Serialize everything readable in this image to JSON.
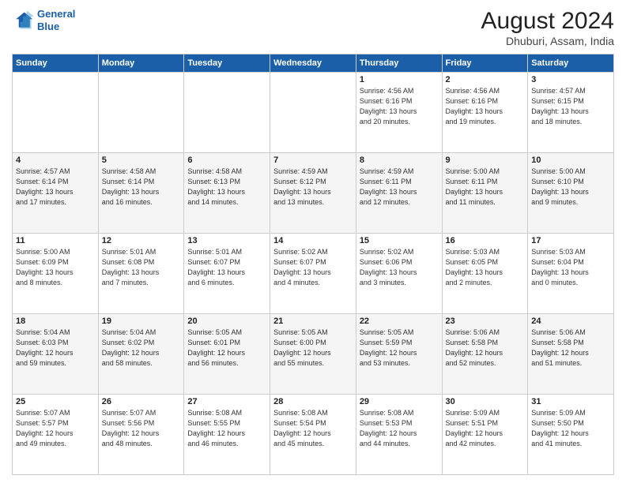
{
  "header": {
    "logo": {
      "line1": "General",
      "line2": "Blue"
    },
    "title": "August 2024",
    "subtitle": "Dhuburi, Assam, India"
  },
  "weekdays": [
    "Sunday",
    "Monday",
    "Tuesday",
    "Wednesday",
    "Thursday",
    "Friday",
    "Saturday"
  ],
  "weeks": [
    [
      {
        "day": "",
        "info": ""
      },
      {
        "day": "",
        "info": ""
      },
      {
        "day": "",
        "info": ""
      },
      {
        "day": "",
        "info": ""
      },
      {
        "day": "1",
        "info": "Sunrise: 4:56 AM\nSunset: 6:16 PM\nDaylight: 13 hours\nand 20 minutes."
      },
      {
        "day": "2",
        "info": "Sunrise: 4:56 AM\nSunset: 6:16 PM\nDaylight: 13 hours\nand 19 minutes."
      },
      {
        "day": "3",
        "info": "Sunrise: 4:57 AM\nSunset: 6:15 PM\nDaylight: 13 hours\nand 18 minutes."
      }
    ],
    [
      {
        "day": "4",
        "info": "Sunrise: 4:57 AM\nSunset: 6:14 PM\nDaylight: 13 hours\nand 17 minutes."
      },
      {
        "day": "5",
        "info": "Sunrise: 4:58 AM\nSunset: 6:14 PM\nDaylight: 13 hours\nand 16 minutes."
      },
      {
        "day": "6",
        "info": "Sunrise: 4:58 AM\nSunset: 6:13 PM\nDaylight: 13 hours\nand 14 minutes."
      },
      {
        "day": "7",
        "info": "Sunrise: 4:59 AM\nSunset: 6:12 PM\nDaylight: 13 hours\nand 13 minutes."
      },
      {
        "day": "8",
        "info": "Sunrise: 4:59 AM\nSunset: 6:11 PM\nDaylight: 13 hours\nand 12 minutes."
      },
      {
        "day": "9",
        "info": "Sunrise: 5:00 AM\nSunset: 6:11 PM\nDaylight: 13 hours\nand 11 minutes."
      },
      {
        "day": "10",
        "info": "Sunrise: 5:00 AM\nSunset: 6:10 PM\nDaylight: 13 hours\nand 9 minutes."
      }
    ],
    [
      {
        "day": "11",
        "info": "Sunrise: 5:00 AM\nSunset: 6:09 PM\nDaylight: 13 hours\nand 8 minutes."
      },
      {
        "day": "12",
        "info": "Sunrise: 5:01 AM\nSunset: 6:08 PM\nDaylight: 13 hours\nand 7 minutes."
      },
      {
        "day": "13",
        "info": "Sunrise: 5:01 AM\nSunset: 6:07 PM\nDaylight: 13 hours\nand 6 minutes."
      },
      {
        "day": "14",
        "info": "Sunrise: 5:02 AM\nSunset: 6:07 PM\nDaylight: 13 hours\nand 4 minutes."
      },
      {
        "day": "15",
        "info": "Sunrise: 5:02 AM\nSunset: 6:06 PM\nDaylight: 13 hours\nand 3 minutes."
      },
      {
        "day": "16",
        "info": "Sunrise: 5:03 AM\nSunset: 6:05 PM\nDaylight: 13 hours\nand 2 minutes."
      },
      {
        "day": "17",
        "info": "Sunrise: 5:03 AM\nSunset: 6:04 PM\nDaylight: 13 hours\nand 0 minutes."
      }
    ],
    [
      {
        "day": "18",
        "info": "Sunrise: 5:04 AM\nSunset: 6:03 PM\nDaylight: 12 hours\nand 59 minutes."
      },
      {
        "day": "19",
        "info": "Sunrise: 5:04 AM\nSunset: 6:02 PM\nDaylight: 12 hours\nand 58 minutes."
      },
      {
        "day": "20",
        "info": "Sunrise: 5:05 AM\nSunset: 6:01 PM\nDaylight: 12 hours\nand 56 minutes."
      },
      {
        "day": "21",
        "info": "Sunrise: 5:05 AM\nSunset: 6:00 PM\nDaylight: 12 hours\nand 55 minutes."
      },
      {
        "day": "22",
        "info": "Sunrise: 5:05 AM\nSunset: 5:59 PM\nDaylight: 12 hours\nand 53 minutes."
      },
      {
        "day": "23",
        "info": "Sunrise: 5:06 AM\nSunset: 5:58 PM\nDaylight: 12 hours\nand 52 minutes."
      },
      {
        "day": "24",
        "info": "Sunrise: 5:06 AM\nSunset: 5:58 PM\nDaylight: 12 hours\nand 51 minutes."
      }
    ],
    [
      {
        "day": "25",
        "info": "Sunrise: 5:07 AM\nSunset: 5:57 PM\nDaylight: 12 hours\nand 49 minutes."
      },
      {
        "day": "26",
        "info": "Sunrise: 5:07 AM\nSunset: 5:56 PM\nDaylight: 12 hours\nand 48 minutes."
      },
      {
        "day": "27",
        "info": "Sunrise: 5:08 AM\nSunset: 5:55 PM\nDaylight: 12 hours\nand 46 minutes."
      },
      {
        "day": "28",
        "info": "Sunrise: 5:08 AM\nSunset: 5:54 PM\nDaylight: 12 hours\nand 45 minutes."
      },
      {
        "day": "29",
        "info": "Sunrise: 5:08 AM\nSunset: 5:53 PM\nDaylight: 12 hours\nand 44 minutes."
      },
      {
        "day": "30",
        "info": "Sunrise: 5:09 AM\nSunset: 5:51 PM\nDaylight: 12 hours\nand 42 minutes."
      },
      {
        "day": "31",
        "info": "Sunrise: 5:09 AM\nSunset: 5:50 PM\nDaylight: 12 hours\nand 41 minutes."
      }
    ]
  ]
}
